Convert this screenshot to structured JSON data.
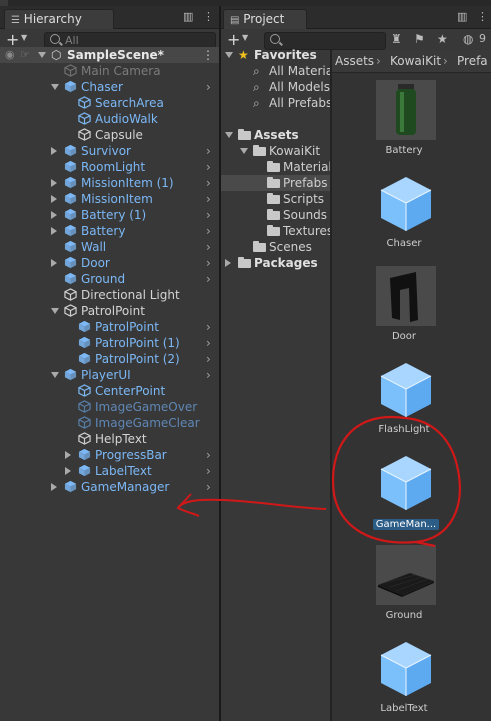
{
  "hierarchy": {
    "tab": "Hierarchy",
    "search_placeholder": "All",
    "scene": "SampleScene*",
    "items": [
      {
        "label": "Main Camera"
      },
      {
        "label": "Chaser"
      },
      {
        "label": "SearchArea"
      },
      {
        "label": "AudioWalk"
      },
      {
        "label": "Capsule"
      },
      {
        "label": "Survivor"
      },
      {
        "label": "RoomLight"
      },
      {
        "label": "MissionItem (1)"
      },
      {
        "label": "MissionItem"
      },
      {
        "label": "Battery (1)"
      },
      {
        "label": "Battery"
      },
      {
        "label": "Wall"
      },
      {
        "label": "Door"
      },
      {
        "label": "Ground"
      },
      {
        "label": "Directional Light"
      },
      {
        "label": "PatrolPoint"
      },
      {
        "label": "PatrolPoint"
      },
      {
        "label": "PatrolPoint (1)"
      },
      {
        "label": "PatrolPoint (2)"
      },
      {
        "label": "PlayerUI"
      },
      {
        "label": "CenterPoint"
      },
      {
        "label": "ImageGameOver"
      },
      {
        "label": "ImageGameClear"
      },
      {
        "label": "HelpText"
      },
      {
        "label": "ProgressBar"
      },
      {
        "label": "LabelText"
      },
      {
        "label": "GameManager"
      }
    ]
  },
  "project": {
    "tab": "Project",
    "eye_count": "9",
    "breadcrumb": [
      "Assets",
      "KowaiKit",
      "Prefa"
    ],
    "tree": [
      {
        "label": "Favorites"
      },
      {
        "label": "All Materia"
      },
      {
        "label": "All Models"
      },
      {
        "label": "All Prefabs"
      },
      {
        "label": "Assets"
      },
      {
        "label": "KowaiKit"
      },
      {
        "label": "Material"
      },
      {
        "label": "Prefabs"
      },
      {
        "label": "Scripts"
      },
      {
        "label": "Sounds"
      },
      {
        "label": "Textures"
      },
      {
        "label": "Scenes"
      },
      {
        "label": "Packages"
      }
    ],
    "assets": [
      {
        "label": "Battery"
      },
      {
        "label": "Chaser"
      },
      {
        "label": "Door"
      },
      {
        "label": "FlashLight"
      },
      {
        "label": "GameMan..."
      },
      {
        "label": "Ground"
      },
      {
        "label": "LabelText"
      }
    ]
  },
  "colors": {
    "prefab_blue": "#7cb8f6",
    "annotation_red": "#d11818",
    "selection": "#2c5d87"
  }
}
